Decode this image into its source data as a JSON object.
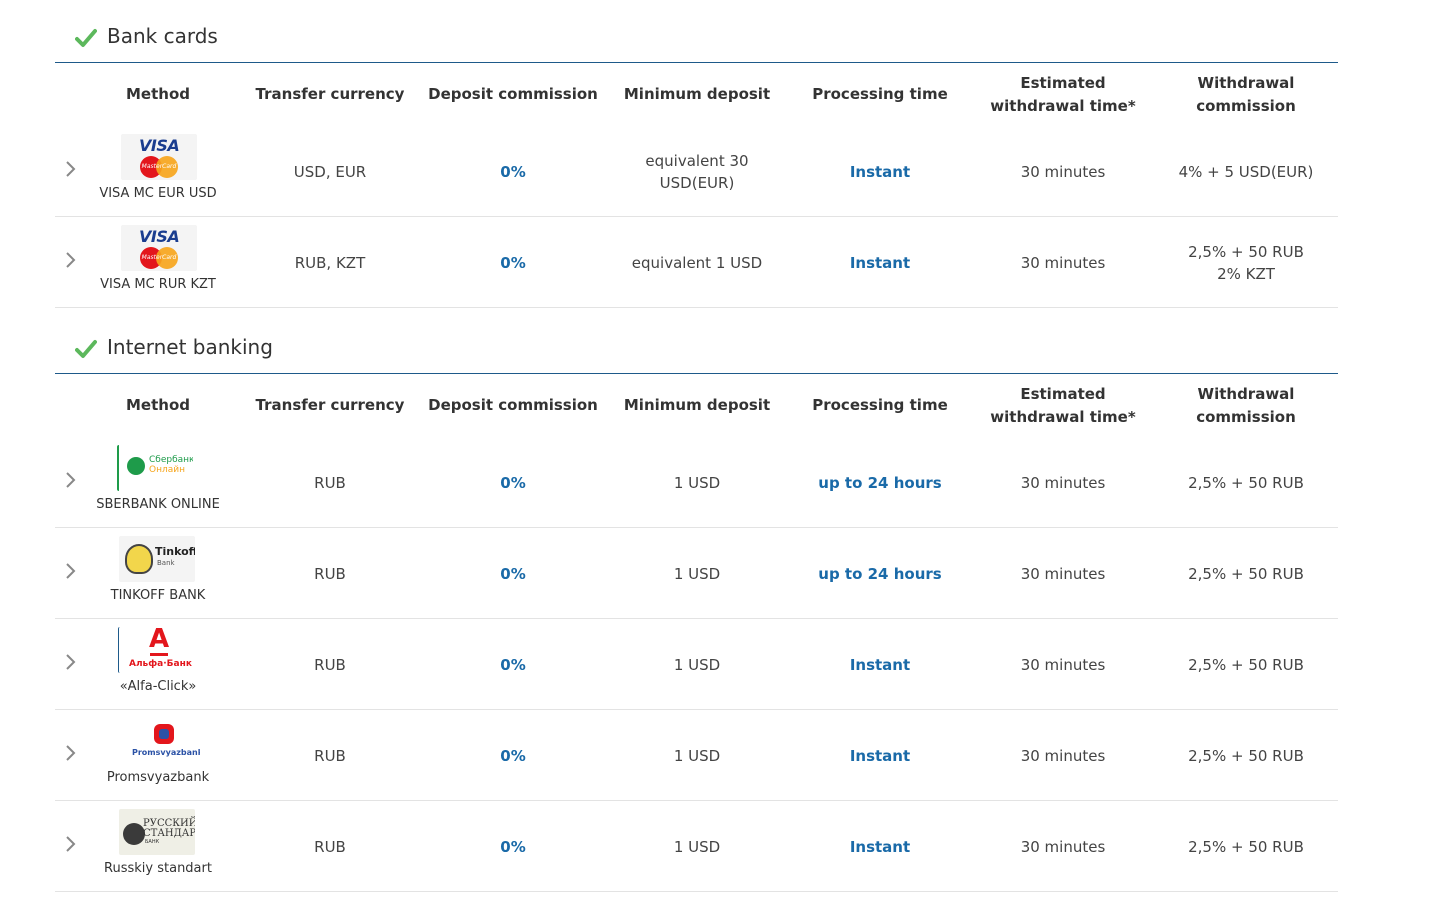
{
  "headers": {
    "method": "Method",
    "currency": "Transfer currency",
    "deposit_commission": "Deposit commission",
    "minimum_deposit": "Minimum deposit",
    "processing_time": "Processing time",
    "estimated_withdrawal_line1": "Estimated",
    "estimated_withdrawal_line2": "withdrawal time*",
    "withdrawal_commission_line1": "Withdrawal",
    "withdrawal_commission_line2": "commission"
  },
  "sections": [
    {
      "title": "Bank cards",
      "rows": [
        {
          "method": "VISA MC EUR USD",
          "logo": "visa-mastercard-logo",
          "logo_text": {
            "visa": "VISA",
            "mc": "MasterCard"
          },
          "currency": "USD, EUR",
          "deposit_commission": "0%",
          "minimum_deposit_line1": "equivalent 30",
          "minimum_deposit_line2": "USD(EUR)",
          "processing_time": "Instant",
          "estimated_withdrawal": "30 minutes",
          "withdrawal_commission_line1": "4% + 5 USD(EUR)",
          "withdrawal_commission_line2": ""
        },
        {
          "method": "VISA MC RUR KZT",
          "logo": "visa-mastercard-logo",
          "logo_text": {
            "visa": "VISA",
            "mc": "MasterCard"
          },
          "currency": "RUB, KZT",
          "deposit_commission": "0%",
          "minimum_deposit_line1": "equivalent 1 USD",
          "minimum_deposit_line2": "",
          "processing_time": "Instant",
          "estimated_withdrawal": "30 minutes",
          "withdrawal_commission_line1": "2,5% + 50 RUB",
          "withdrawal_commission_line2": "2% KZT"
        }
      ]
    },
    {
      "title": "Internet banking",
      "rows": [
        {
          "method": "SBERBANK ONLINE",
          "logo": "sberbank-logo",
          "logo_text": {
            "line1": "Сбербанк",
            "line2": "Онлайн"
          },
          "currency": "RUB",
          "deposit_commission": "0%",
          "minimum_deposit_line1": "1 USD",
          "minimum_deposit_line2": "",
          "processing_time": "up to 24 hours",
          "estimated_withdrawal": "30 minutes",
          "withdrawal_commission_line1": "2,5% + 50 RUB",
          "withdrawal_commission_line2": ""
        },
        {
          "method": "TINKOFF BANK",
          "logo": "tinkoff-logo",
          "logo_text": {
            "line1": "Tinkoff",
            "line2": "Bank"
          },
          "currency": "RUB",
          "deposit_commission": "0%",
          "minimum_deposit_line1": "1 USD",
          "minimum_deposit_line2": "",
          "processing_time": "up to 24 hours",
          "estimated_withdrawal": "30 minutes",
          "withdrawal_commission_line1": "2,5% + 50 RUB",
          "withdrawal_commission_line2": ""
        },
        {
          "method": "«Alfa-Click»",
          "logo": "alfa-bank-logo",
          "logo_text": {
            "letter": "А",
            "line1": "Альфа·Банк"
          },
          "currency": "RUB",
          "deposit_commission": "0%",
          "minimum_deposit_line1": "1 USD",
          "minimum_deposit_line2": "",
          "processing_time": "Instant",
          "estimated_withdrawal": "30 minutes",
          "withdrawal_commission_line1": "2,5% + 50 RUB",
          "withdrawal_commission_line2": ""
        },
        {
          "method": "Promsvyazbank",
          "logo": "promsvyazbank-logo",
          "logo_text": {
            "line1": "Promsvyazbank"
          },
          "currency": "RUB",
          "deposit_commission": "0%",
          "minimum_deposit_line1": "1 USD",
          "minimum_deposit_line2": "",
          "processing_time": "Instant",
          "estimated_withdrawal": "30 minutes",
          "withdrawal_commission_line1": "2,5% + 50 RUB",
          "withdrawal_commission_line2": ""
        },
        {
          "method": "Russkiy standart",
          "logo": "russkiy-standart-logo",
          "logo_text": {
            "line1": "РУССКИЙ",
            "line2": "СТАНДАРТ",
            "line3": "БАНК"
          },
          "currency": "RUB",
          "deposit_commission": "0%",
          "minimum_deposit_line1": "1 USD",
          "minimum_deposit_line2": "",
          "processing_time": "Instant",
          "estimated_withdrawal": "30 minutes",
          "withdrawal_commission_line1": "2,5% + 50 RUB",
          "withdrawal_commission_line2": ""
        }
      ]
    }
  ],
  "colors": {
    "accent_blue": "#1a6aa8",
    "rule_blue": "#1e5a8a",
    "check_green": "#5cb85c",
    "text": "#333333"
  }
}
